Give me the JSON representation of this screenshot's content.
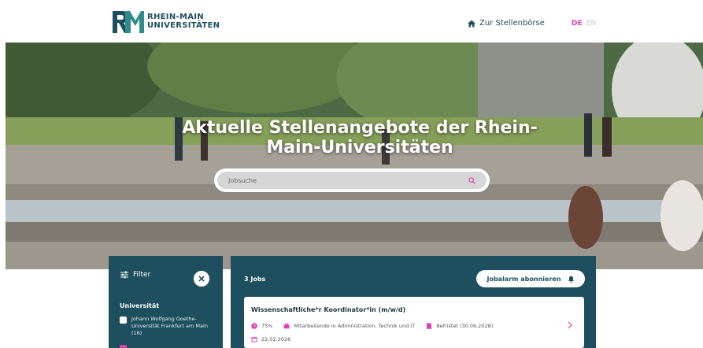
{
  "header": {
    "logo_line1": "RHEIN-MAIN",
    "logo_line2": "UNIVERSITÄTEN",
    "nav_link": "Zur Stellenbörse",
    "lang_active": "DE",
    "lang_inactive": "EN"
  },
  "hero": {
    "title": "Aktuelle Stellenangebote der Rhein-Main-Universitäten",
    "search_placeholder": "Jobsuche"
  },
  "filter": {
    "label": "Filter",
    "group_title": "Universität",
    "options": [
      {
        "label": "Johann Wolfgang Goethe-Universität Frankfurt am Main (16)",
        "checked": false
      }
    ]
  },
  "results": {
    "count": "3 Jobs",
    "alarm_button": "Jobalarm abonnieren",
    "jobs": [
      {
        "title": "Wissenschaftliche*r Koordinator*in (m/w/d)",
        "percent": "75%",
        "category": "Mitarbeitende in Administration, Technik und IT",
        "term": "Befristet (30.06.2028)",
        "date": "22.02.2026"
      }
    ]
  },
  "colors": {
    "brand_dark": "#1d4f5e",
    "accent_pink": "#e23fb1"
  }
}
